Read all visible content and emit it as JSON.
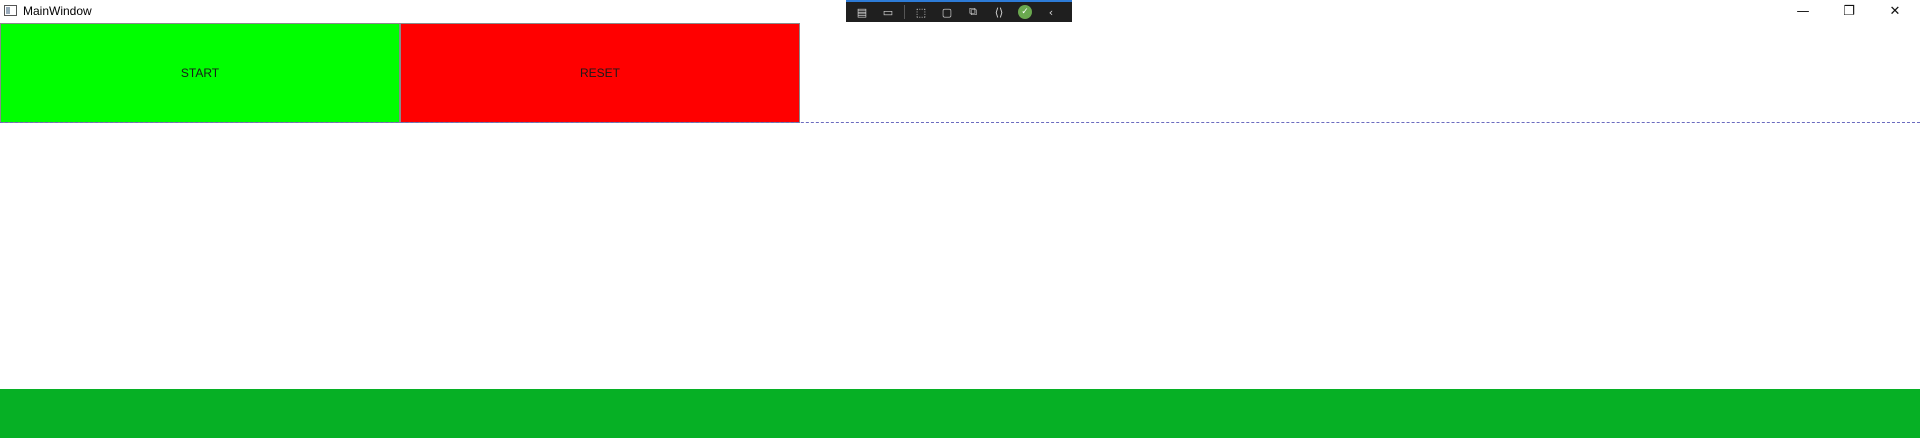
{
  "window": {
    "title": "MainWindow",
    "controls": {
      "minimize": "—",
      "maximize": "❐",
      "close": "✕"
    }
  },
  "debug_toolbar": {
    "items": [
      {
        "name": "live-visual-tree-icon",
        "glyph": "▤"
      },
      {
        "name": "video-camera-icon",
        "glyph": "▭"
      },
      {
        "name": "select-element-icon",
        "glyph": "⬚"
      },
      {
        "name": "display-layout-adorners-icon",
        "glyph": "▢"
      },
      {
        "name": "track-focus-icon",
        "glyph": "⧉"
      },
      {
        "name": "binding-failures-icon",
        "glyph": "⟨⟩"
      },
      {
        "name": "check-icon",
        "glyph": "✓"
      },
      {
        "name": "collapse-chevron-icon",
        "glyph": "‹"
      }
    ]
  },
  "buttons": {
    "start_label": "START",
    "reset_label": "RESET"
  },
  "colors": {
    "start": "#00ff00",
    "reset": "#ff0000",
    "progress": "#06b025"
  },
  "progress": {
    "value_percent": 100
  }
}
